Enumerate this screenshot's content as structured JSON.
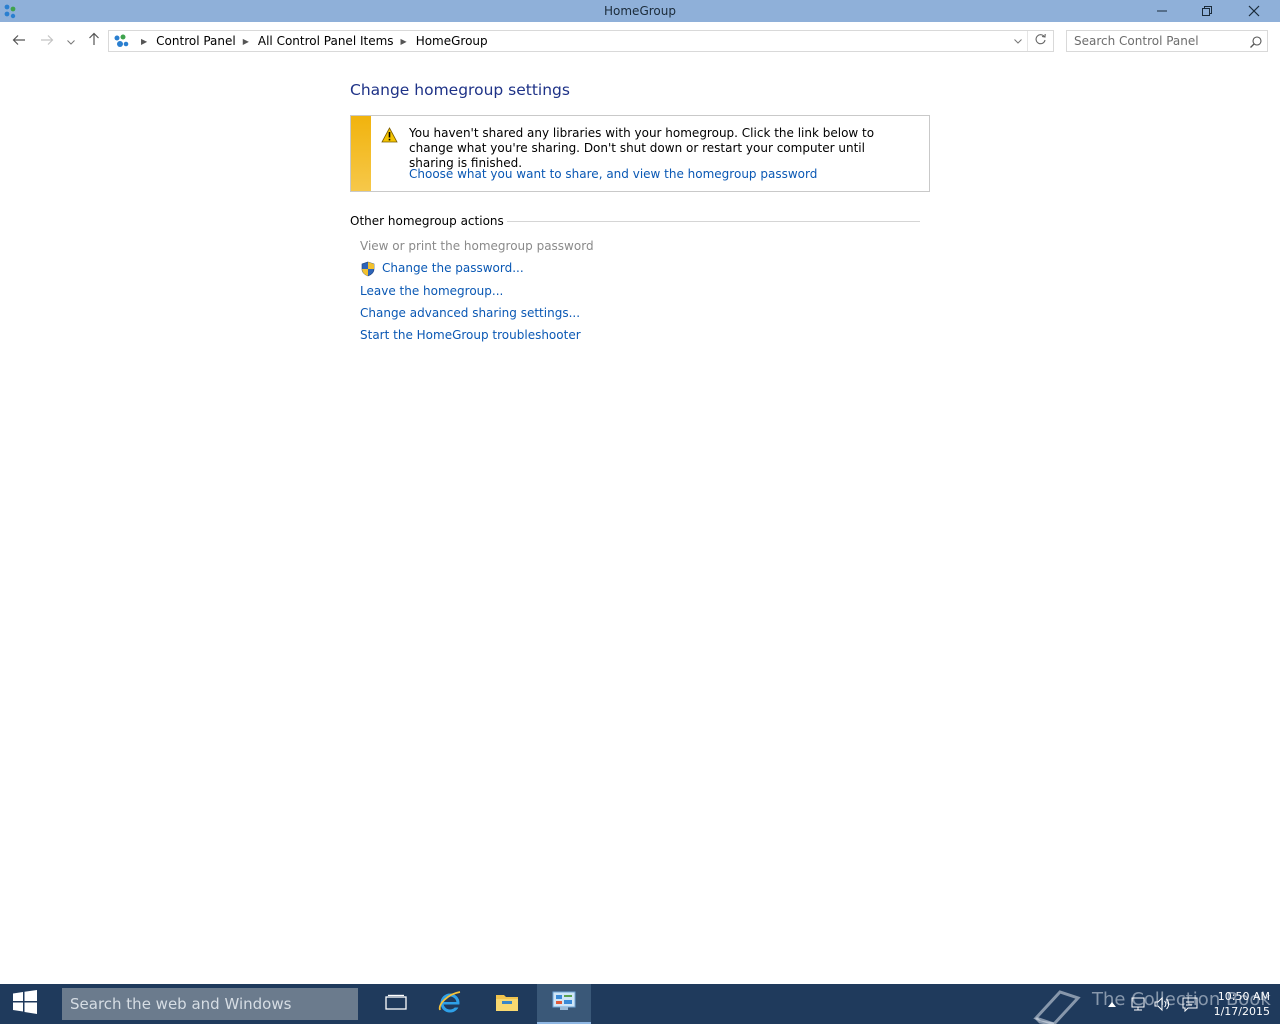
{
  "window": {
    "title": "HomeGroup"
  },
  "address": {
    "crumbs": [
      "Control Panel",
      "All Control Panel Items",
      "HomeGroup"
    ]
  },
  "search": {
    "placeholder": "Search Control Panel"
  },
  "main": {
    "title": "Change homegroup settings",
    "warning": {
      "message": "You haven't shared any libraries with your homegroup. Click the link below to change what you're sharing. Don't shut down or restart your computer until sharing is finished.",
      "link": "Choose what you want to share, and view the homegroup password"
    },
    "other_actions": {
      "heading": "Other homegroup actions",
      "items": [
        "View or print the homegroup password",
        "Change the password...",
        "Leave the homegroup...",
        "Change advanced sharing settings...",
        "Start the HomeGroup troubleshooter"
      ]
    }
  },
  "taskbar": {
    "search_placeholder": "Search the web and Windows",
    "watermark": "The Collection Book",
    "time": "10:50 AM",
    "date": "1/17/2015"
  },
  "colors": {
    "titlebar": "#8fb0d9",
    "link": "#0a58b4",
    "heading": "#1e3287",
    "warning_stripe": "#f1b30d",
    "taskbar": "#1f3a5c"
  }
}
